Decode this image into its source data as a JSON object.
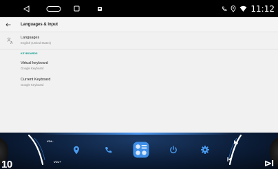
{
  "status_bar": {
    "time": "11:12",
    "icons": [
      "back-triangle-icon",
      "home-pill-icon",
      "recents-square-icon",
      "notification-icon",
      "phone-icon",
      "location-icon",
      "wifi-icon"
    ]
  },
  "settings": {
    "title": "Languages & input",
    "languages": {
      "title": "Languages",
      "subtitle": "English (United States)"
    },
    "section_header": "KEYBOARDS",
    "virtual_keyboard": {
      "title": "Virtual keyboard",
      "subtitle": "Google Keyboard"
    },
    "current_keyboard": {
      "title": "Current Keyboard",
      "subtitle": "Google Keyboard"
    }
  },
  "dock": {
    "vol_up": "VOL+",
    "vol_down": "VOL-",
    "left_text": "10",
    "right_text": "⊳I",
    "buttons": [
      "location-icon",
      "phone-icon",
      "apps-grid-icon",
      "power-icon",
      "settings-icon"
    ],
    "accent_color": "#3f8fe8",
    "icon_color": "#4a9cf0"
  }
}
